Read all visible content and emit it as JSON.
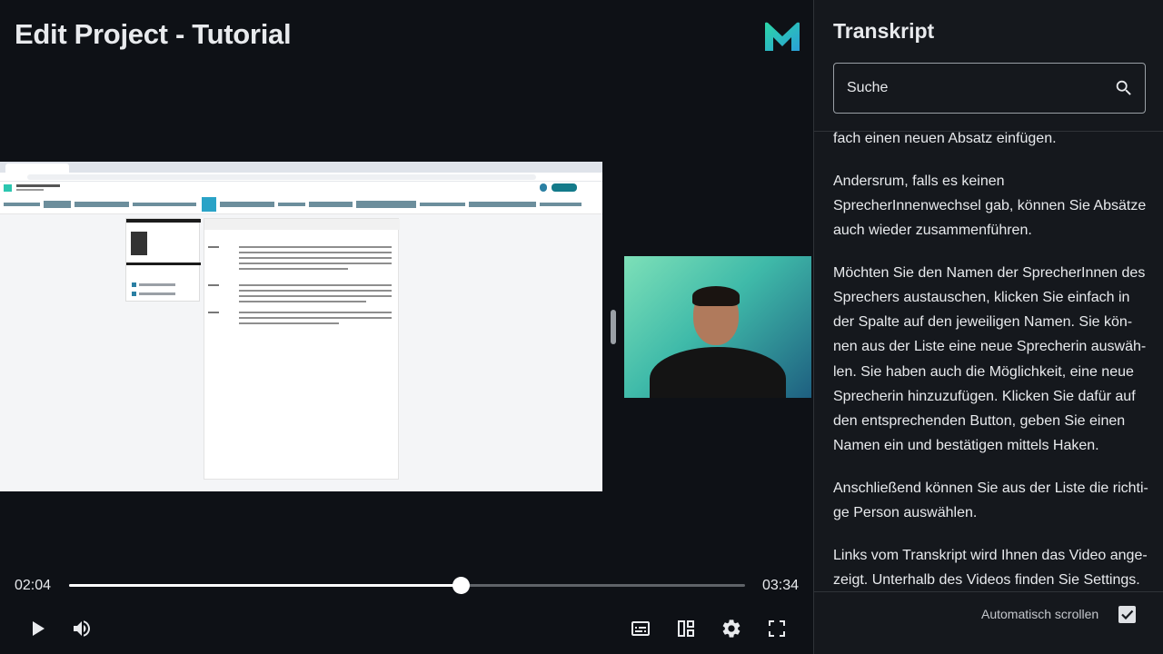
{
  "player": {
    "title": "Edit Project - Tutorial",
    "logo_icon": "m-logo-icon",
    "current_time": "02:04",
    "duration": "03:34",
    "progress": 0.579,
    "controls": {
      "play_icon": "play-icon",
      "volume_icon": "volume-icon",
      "subtitles_icon": "subtitles-icon",
      "layout_icon": "layout-icon",
      "settings_icon": "gear-icon",
      "fullscreen_icon": "fullscreen-icon"
    }
  },
  "sidebar": {
    "title": "Transkript",
    "search": {
      "placeholder": "Suche",
      "icon": "search-icon"
    },
    "paragraphs": [
      "fach einen neuen Absatz einfügen.",
      "Andersrum, falls es keinen SprecherInnenwechsel gab, können Sie Absätze auch wieder zusammenführen.",
      "Möchten Sie den Namen der SprecherInnen des Sprechers austauschen, klicken Sie einfach in der Spalte auf den jeweiligen Namen. Sie kön-nen aus der Liste eine neue Sprecherin auswäh-len. Sie haben auch die Möglichkeit, eine neue Sprecherin hinzuzufügen. Klicken Sie dafür auf den entsprechenden Button, geben Sie einen Namen ein und bestätigen mittels Haken.",
      "Anschließend können Sie aus der Liste die richti-ge Person auswählen.",
      "Links vom Transkript wird Ihnen das Video ange-zeigt. Unterhalb des Videos finden Sie Settings."
    ],
    "autoscroll_label": "Automatisch scrollen",
    "autoscroll_checked": true
  },
  "colors": {
    "background": "#0e1116",
    "sidebar_bg": "#15181d",
    "text": "#e8eaed",
    "accent_logo": "#2bd3b3"
  }
}
